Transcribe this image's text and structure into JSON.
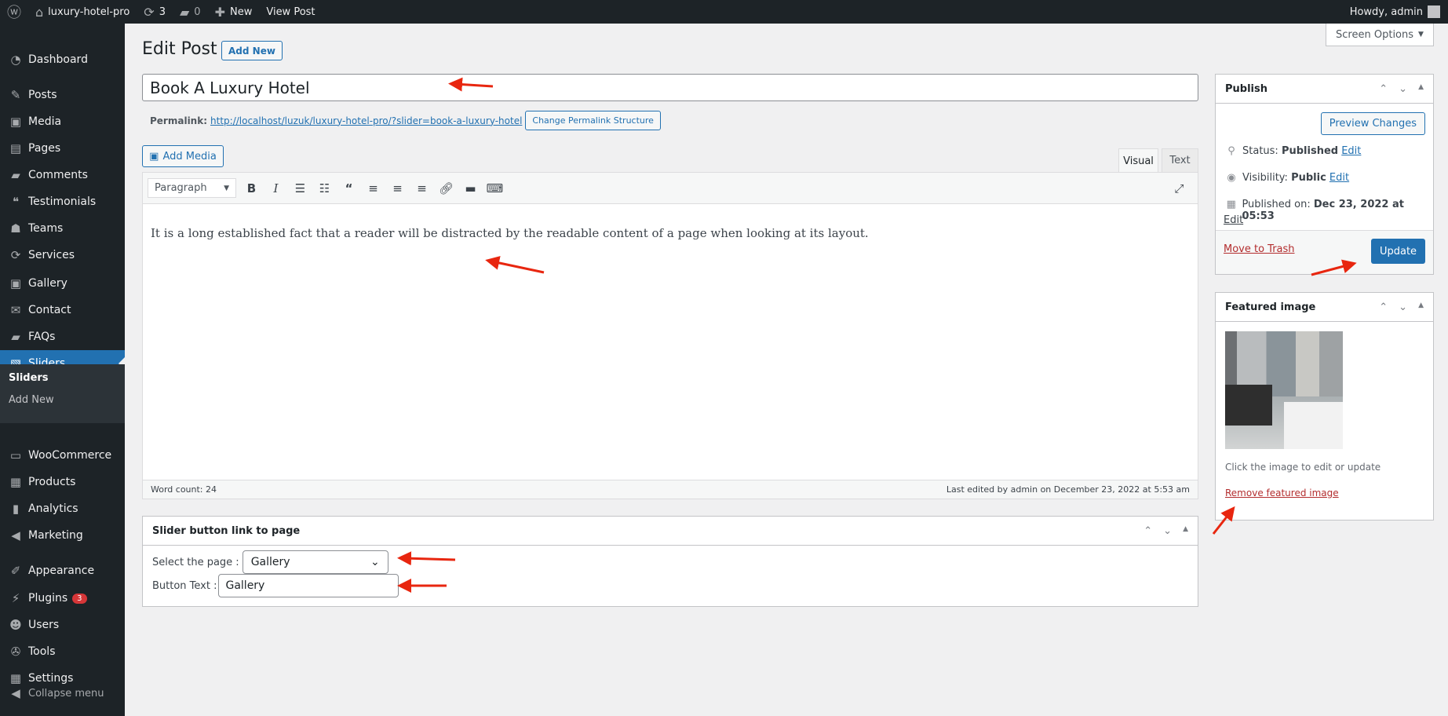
{
  "admin_bar": {
    "site_name": "luxury-hotel-pro",
    "updates_count": "3",
    "comments_count": "0",
    "new_label": "New",
    "view_post_label": "View Post",
    "greeting": "Howdy, admin"
  },
  "sidebar": {
    "items": [
      {
        "label": "Dashboard",
        "icon": "dashboard-icon"
      },
      {
        "label": "Posts",
        "icon": "pin-icon"
      },
      {
        "label": "Media",
        "icon": "media-icon"
      },
      {
        "label": "Pages",
        "icon": "pages-icon"
      },
      {
        "label": "Comments",
        "icon": "comment-icon"
      },
      {
        "label": "Testimonials",
        "icon": "testimonial-icon"
      },
      {
        "label": "Teams",
        "icon": "groups-icon"
      },
      {
        "label": "Services",
        "icon": "update-icon"
      },
      {
        "label": "Gallery",
        "icon": "gallery-icon"
      },
      {
        "label": "Contact",
        "icon": "mail-icon"
      },
      {
        "label": "FAQs",
        "icon": "chat-icon"
      },
      {
        "label": "Sliders",
        "icon": "slides-icon",
        "active": true
      },
      {
        "label": "WooCommerce",
        "icon": "woo-icon"
      },
      {
        "label": "Products",
        "icon": "archive-icon"
      },
      {
        "label": "Analytics",
        "icon": "chart-icon"
      },
      {
        "label": "Marketing",
        "icon": "megaphone-icon"
      },
      {
        "label": "Appearance",
        "icon": "brush-icon"
      },
      {
        "label": "Plugins",
        "icon": "plugin-icon",
        "badge": "3"
      },
      {
        "label": "Users",
        "icon": "users-icon"
      },
      {
        "label": "Tools",
        "icon": "wrench-icon"
      },
      {
        "label": "Settings",
        "icon": "settings-icon"
      },
      {
        "label": "Collapse menu",
        "icon": "collapse-icon"
      }
    ],
    "submenu": [
      {
        "label": "Sliders",
        "current": true
      },
      {
        "label": "Add New"
      }
    ]
  },
  "header": {
    "title": "Edit Post",
    "add_new": "Add New",
    "screen_options": "Screen Options"
  },
  "post": {
    "title": "Book A Luxury Hotel",
    "permalink_label": "Permalink:",
    "permalink_url": "http://localhost/luzuk/luxury-hotel-pro/?slider=book-a-luxury-hotel",
    "change_permalink": "Change Permalink Structure"
  },
  "editor": {
    "add_media": "Add Media",
    "tabs": [
      "Visual",
      "Text"
    ],
    "active_tab": "Visual",
    "format": "Paragraph",
    "content": "It is a long established fact that a reader will be distracted by the readable content of a page when looking at its layout.",
    "word_count": "Word count: 24",
    "last_edited": "Last edited by admin on December 23, 2022 at 5:53 am"
  },
  "slider_box": {
    "title": "Slider button link to page",
    "select_label": "Select the page :",
    "select_value": "Gallery",
    "button_text_label": "Button Text :",
    "button_text_value": "Gallery"
  },
  "publish": {
    "title": "Publish",
    "preview": "Preview Changes",
    "status_label": "Status:",
    "status_value": "Published",
    "visibility_label": "Visibility:",
    "visibility_value": "Public",
    "published_on_label": "Published on:",
    "published_on_value": "Dec 23, 2022 at 05:53",
    "edit": "Edit",
    "trash": "Move to Trash",
    "update": "Update"
  },
  "featured": {
    "title": "Featured image",
    "hint": "Click the image to edit or update",
    "remove": "Remove featured image"
  },
  "colors": {
    "accent": "#2271b1",
    "admin_bar": "#1d2327",
    "annotation_arrow": "#e8260f",
    "trash": "#b32d2e"
  }
}
